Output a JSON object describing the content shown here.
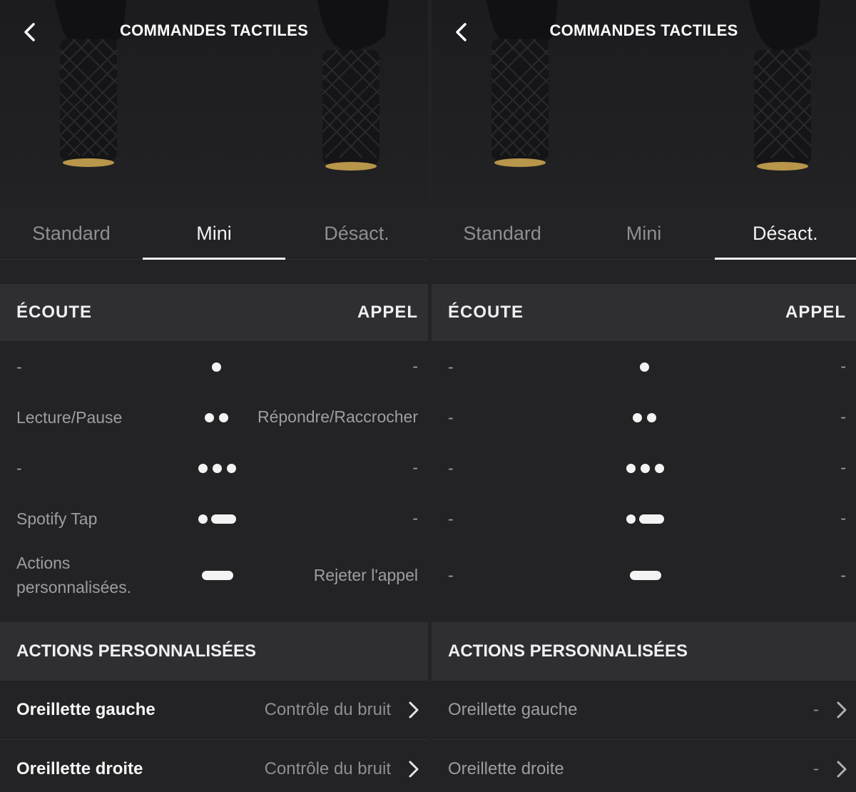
{
  "screens": [
    {
      "title": "COMMANDES TACTILES",
      "tabs": [
        "Standard",
        "Mini",
        "Désact."
      ],
      "active_tab": 1,
      "section_left": "ÉCOUTE",
      "section_right": "APPEL",
      "gestures": [
        {
          "listen": "-",
          "call": "-",
          "pattern": "single-tap"
        },
        {
          "listen": "Lecture/Pause",
          "call": "Répondre/Raccrocher",
          "pattern": "double-tap"
        },
        {
          "listen": "-",
          "call": "-",
          "pattern": "triple-tap"
        },
        {
          "listen": "Spotify Tap",
          "call": "-",
          "pattern": "tap-and-hold"
        },
        {
          "listen": "Actions personnalisées.",
          "call": "Rejeter l'appel",
          "pattern": "long-press"
        }
      ],
      "custom_head": "ACTIONS PERSONNALISÉES",
      "custom_rows": [
        {
          "label": "Oreillette gauche",
          "value": "Contrôle du bruit"
        },
        {
          "label": "Oreillette droite",
          "value": "Contrôle du bruit"
        }
      ]
    },
    {
      "title": "COMMANDES TACTILES",
      "tabs": [
        "Standard",
        "Mini",
        "Désact."
      ],
      "active_tab": 2,
      "section_left": "ÉCOUTE",
      "section_right": "APPEL",
      "gestures": [
        {
          "listen": "-",
          "call": "-",
          "pattern": "single-tap"
        },
        {
          "listen": "-",
          "call": "-",
          "pattern": "double-tap"
        },
        {
          "listen": "-",
          "call": "-",
          "pattern": "triple-tap"
        },
        {
          "listen": "-",
          "call": "-",
          "pattern": "tap-and-hold"
        },
        {
          "listen": "-",
          "call": "-",
          "pattern": "long-press"
        }
      ],
      "custom_head": "ACTIONS PERSONNALISÉES",
      "custom_rows": [
        {
          "label": "Oreillette gauche",
          "value": "-"
        },
        {
          "label": "Oreillette droite",
          "value": "-"
        }
      ]
    }
  ]
}
